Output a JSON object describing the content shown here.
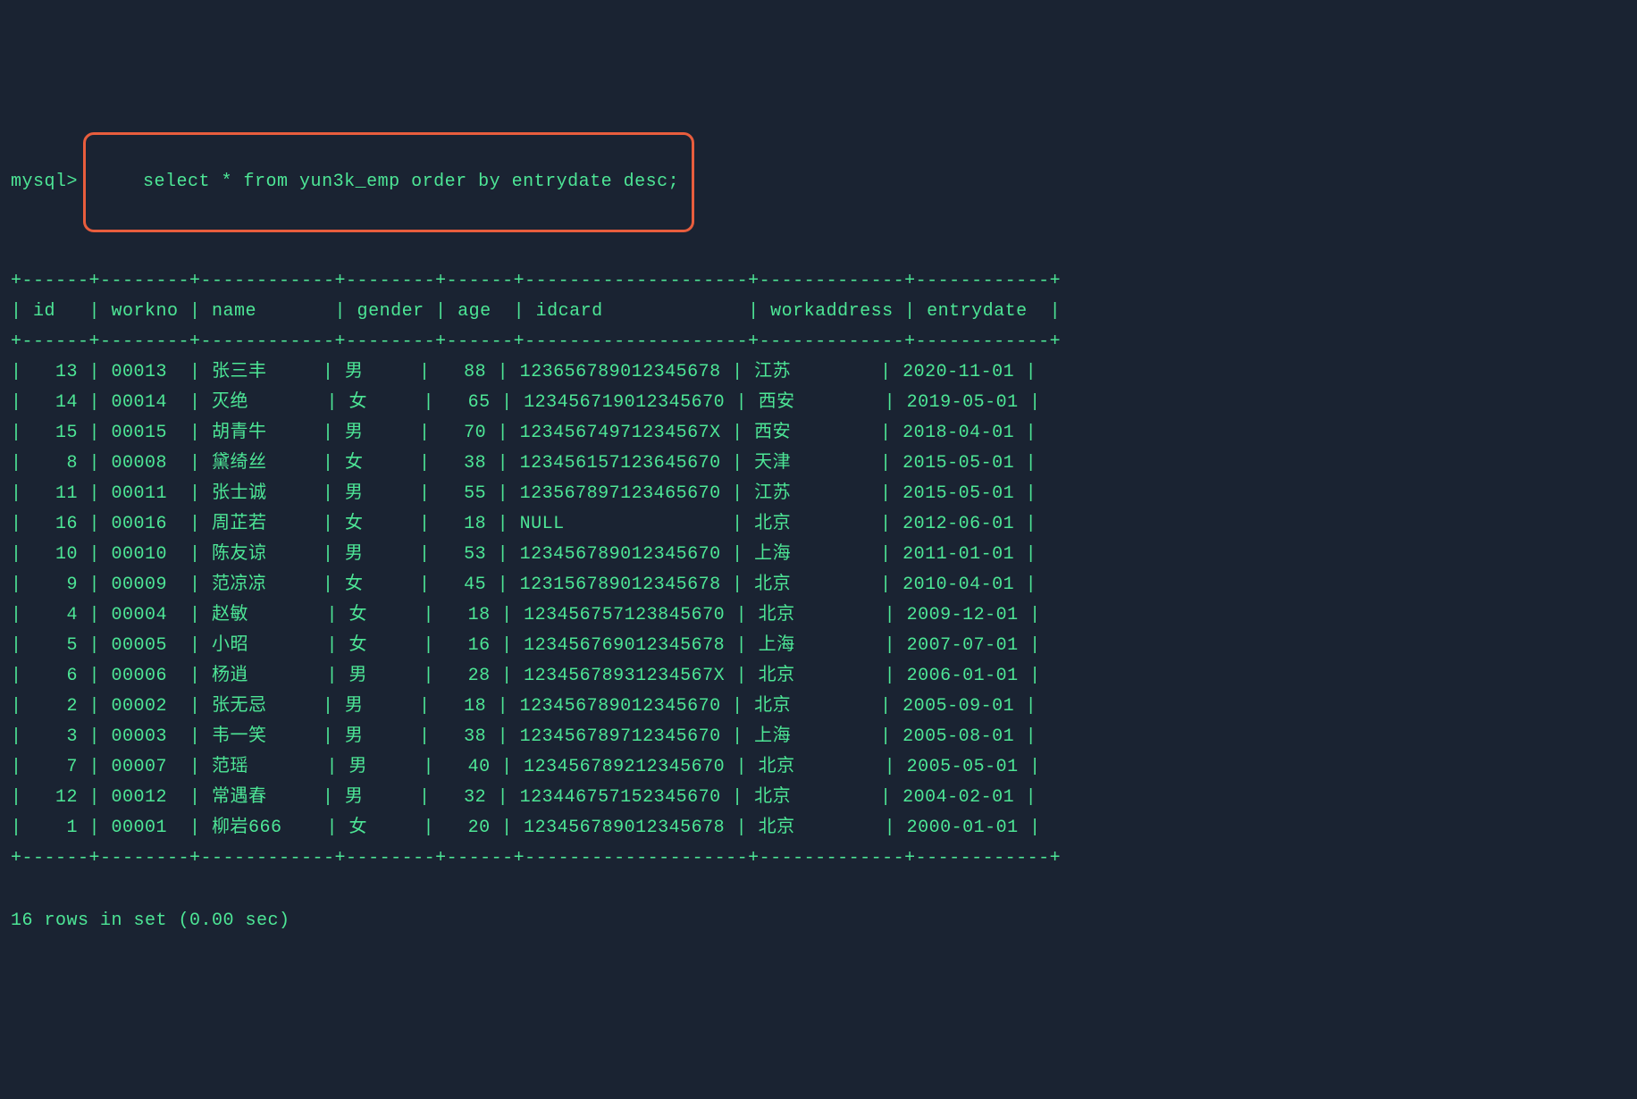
{
  "prompt": "mysql>",
  "query": "select * from yun3k_emp order by entrydate desc;",
  "columns": [
    "id",
    "workno",
    "name",
    "gender",
    "age",
    "idcard",
    "workaddress",
    "entrydate"
  ],
  "rows": [
    {
      "id": "13",
      "workno": "00013",
      "name": "张三丰",
      "gender": "男",
      "age": "88",
      "idcard": "123656789012345678",
      "workaddress": "江苏",
      "entrydate": "2020-11-01"
    },
    {
      "id": "14",
      "workno": "00014",
      "name": "灭绝",
      "gender": "女",
      "age": "65",
      "idcard": "123456719012345670",
      "workaddress": "西安",
      "entrydate": "2019-05-01"
    },
    {
      "id": "15",
      "workno": "00015",
      "name": "胡青牛",
      "gender": "男",
      "age": "70",
      "idcard": "12345674971234567X",
      "workaddress": "西安",
      "entrydate": "2018-04-01"
    },
    {
      "id": "8",
      "workno": "00008",
      "name": "黛绮丝",
      "gender": "女",
      "age": "38",
      "idcard": "123456157123645670",
      "workaddress": "天津",
      "entrydate": "2015-05-01"
    },
    {
      "id": "11",
      "workno": "00011",
      "name": "张士诚",
      "gender": "男",
      "age": "55",
      "idcard": "123567897123465670",
      "workaddress": "江苏",
      "entrydate": "2015-05-01"
    },
    {
      "id": "16",
      "workno": "00016",
      "name": "周芷若",
      "gender": "女",
      "age": "18",
      "idcard": "NULL",
      "workaddress": "北京",
      "entrydate": "2012-06-01"
    },
    {
      "id": "10",
      "workno": "00010",
      "name": "陈友谅",
      "gender": "男",
      "age": "53",
      "idcard": "123456789012345670",
      "workaddress": "上海",
      "entrydate": "2011-01-01"
    },
    {
      "id": "9",
      "workno": "00009",
      "name": "范凉凉",
      "gender": "女",
      "age": "45",
      "idcard": "123156789012345678",
      "workaddress": "北京",
      "entrydate": "2010-04-01"
    },
    {
      "id": "4",
      "workno": "00004",
      "name": "赵敏",
      "gender": "女",
      "age": "18",
      "idcard": "123456757123845670",
      "workaddress": "北京",
      "entrydate": "2009-12-01"
    },
    {
      "id": "5",
      "workno": "00005",
      "name": "小昭",
      "gender": "女",
      "age": "16",
      "idcard": "123456769012345678",
      "workaddress": "上海",
      "entrydate": "2007-07-01"
    },
    {
      "id": "6",
      "workno": "00006",
      "name": "杨逍",
      "gender": "男",
      "age": "28",
      "idcard": "12345678931234567X",
      "workaddress": "北京",
      "entrydate": "2006-01-01"
    },
    {
      "id": "2",
      "workno": "00002",
      "name": "张无忌",
      "gender": "男",
      "age": "18",
      "idcard": "123456789012345670",
      "workaddress": "北京",
      "entrydate": "2005-09-01"
    },
    {
      "id": "3",
      "workno": "00003",
      "name": "韦一笑",
      "gender": "男",
      "age": "38",
      "idcard": "123456789712345670",
      "workaddress": "上海",
      "entrydate": "2005-08-01"
    },
    {
      "id": "7",
      "workno": "00007",
      "name": "范瑶",
      "gender": "男",
      "age": "40",
      "idcard": "123456789212345670",
      "workaddress": "北京",
      "entrydate": "2005-05-01"
    },
    {
      "id": "12",
      "workno": "00012",
      "name": "常遇春",
      "gender": "男",
      "age": "32",
      "idcard": "123446757152345670",
      "workaddress": "北京",
      "entrydate": "2004-02-01"
    },
    {
      "id": "1",
      "workno": "00001",
      "name": "柳岩666",
      "gender": "女",
      "age": "20",
      "idcard": "123456789012345678",
      "workaddress": "北京",
      "entrydate": "2000-01-01"
    }
  ],
  "footer": "16 rows in set (0.00 sec)",
  "colWidths": {
    "id": 4,
    "workno": 6,
    "name": 10,
    "gender": 6,
    "age": 4,
    "idcard": 18,
    "workaddress": 11,
    "entrydate": 10
  }
}
